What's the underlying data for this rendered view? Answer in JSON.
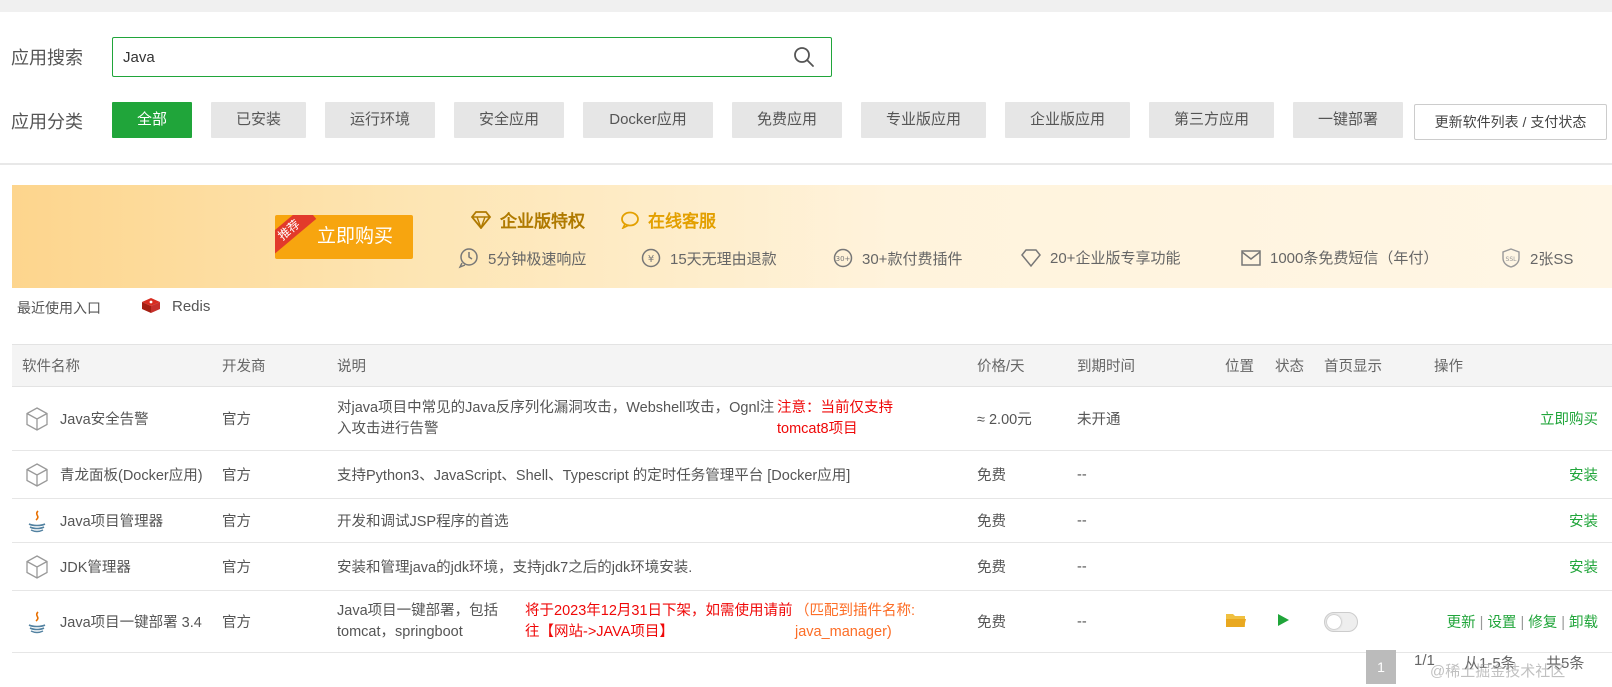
{
  "search": {
    "label": "应用搜索",
    "value": "Java"
  },
  "category": {
    "label": "应用分类",
    "tabs": [
      "全部",
      "已安装",
      "运行环境",
      "安全应用",
      "Docker应用",
      "免费应用",
      "专业版应用",
      "企业版应用",
      "第三方应用",
      "一键部署"
    ],
    "active_index": 0,
    "refresh_label": "更新软件列表 / 支付状态"
  },
  "banner": {
    "tag": "推荐",
    "buy_label": "立即购买",
    "enterprise_title": "企业版特权",
    "service_title": "在线客服",
    "perks": [
      "5分钟极速响应",
      "15天无理由退款",
      "30+款付费插件",
      "20+企业版专享功能",
      "1000条免费短信（年付）",
      "2张SS"
    ]
  },
  "recent": {
    "label": "最近使用入口",
    "item": "Redis"
  },
  "table": {
    "headers": [
      "软件名称",
      "开发商",
      "说明",
      "价格/天",
      "到期时间",
      "位置",
      "状态",
      "首页显示",
      "操作"
    ],
    "rows": [
      {
        "name": "Java安全告警",
        "icon": "box-icon",
        "dev": "官方",
        "desc": "对java项目中常见的Java反序列化漏洞攻击，Webshell攻击，Ognl注入攻击进行告警",
        "note": "注意：当前仅支持tomcat8项目",
        "price": "≈ 2.00元",
        "expire": "未开通",
        "action": "立即购买"
      },
      {
        "name": "青龙面板(Docker应用)",
        "icon": "box-icon",
        "dev": "官方",
        "desc": "支持Python3、JavaScript、Shell、Typescript 的定时任务管理平台 [Docker应用]",
        "price": "免费",
        "expire": "--",
        "action": "安装"
      },
      {
        "name": "Java项目管理器",
        "icon": "java-icon",
        "dev": "官方",
        "desc": "开发和调试JSP程序的首选",
        "price": "免费",
        "expire": "--",
        "action": "安装"
      },
      {
        "name": "JDK管理器",
        "icon": "box-icon",
        "dev": "官方",
        "desc": "安装和管理java的jdk环境，支持jdk7之后的jdk环境安装.",
        "price": "免费",
        "expire": "--",
        "action": "安装"
      },
      {
        "name": "Java项目一键部署 3.4",
        "icon": "java-icon",
        "dev": "官方",
        "desc": "Java项目一键部署，包括tomcat，springboot",
        "note": "将于2023年12月31日下架，如需使用请前往【网站->JAVA项目】",
        "note2": "（匹配到插件名称: java_manager)",
        "price": "免费",
        "expire": "--",
        "actions": [
          "更新",
          "设置",
          "修复",
          "卸载"
        ]
      }
    ]
  },
  "pager": {
    "current": "1",
    "pages": "1/1",
    "range": "从1-5条",
    "total": "共5条"
  },
  "watermark": "@稀土掘金技术社区",
  "colors": {
    "accent": "#20a53a",
    "warn": "#ef0808",
    "price": "#fc6d26"
  }
}
